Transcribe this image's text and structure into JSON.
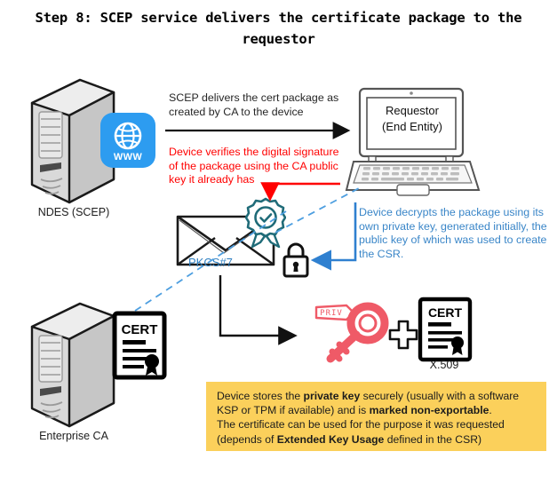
{
  "title": "Step 8: SCEP service delivers the certificate package to the requestor",
  "nodes": {
    "ndes_server": {
      "label": "NDES (SCEP)",
      "icon": "server-tower-icon",
      "badge": {
        "name": "www-globe-icon",
        "text": "WWW",
        "color": "#2d9cf0"
      }
    },
    "enterprise_ca": {
      "label": "Enterprise CA",
      "icon": "server-tower-icon",
      "cert_icon": {
        "name": "certificate-icon",
        "text": "CERT"
      }
    },
    "requestor": {
      "icon": "laptop-icon",
      "screen_line1": "Requestor",
      "screen_line2": "(End Entity)"
    },
    "package": {
      "icon": "envelope-icon",
      "label": "PKCS#7",
      "label_color": "#2e7fc1",
      "seal_icon": "signature-seal-rosette-icon",
      "seal_color": "#1f6b78",
      "lock_icon": "padlock-icon"
    },
    "private_key": {
      "icon": "private-key-icon",
      "tag_text": "PRIV",
      "color": "#ef5a67"
    },
    "plus": {
      "icon": "plus-icon"
    },
    "x509_cert": {
      "icon": "certificate-icon",
      "heading": "CERT",
      "label": "X.509"
    }
  },
  "annotations": {
    "scep_delivers": {
      "text": "SCEP delivers the cert package as created by CA to the device",
      "color": "#262626"
    },
    "device_verifies": {
      "text": "Device verifies the digital signature of the package using the CA public key it already has",
      "color": "#ff0000"
    },
    "device_decrypts": {
      "text": "Device decrypts the package using its own private key, generated initially, the public key of which was used to create the CSR.",
      "color": "#3a86c8"
    }
  },
  "callout": {
    "background": "#fbd05b",
    "lines": [
      [
        {
          "t": "Device stores the ",
          "b": false
        },
        {
          "t": "private key",
          "b": true
        },
        {
          "t": " securely (usually with a software",
          "b": false
        }
      ],
      [
        {
          "t": "KSP or TPM if available) and is ",
          "b": false
        },
        {
          "t": "marked non-exportable",
          "b": true
        },
        {
          "t": ".",
          "b": false
        }
      ],
      [
        {
          "t": "The certificate can be used for the purpose it was requested",
          "b": false
        }
      ],
      [
        {
          "t": "(depends of ",
          "b": false
        },
        {
          "t": "Extended Key Usage",
          "b": true
        },
        {
          "t": " defined in the CSR)",
          "b": false
        }
      ]
    ]
  },
  "connectors": {
    "delivery_arrow": {
      "name": "delivery-arrow",
      "color": "#111111"
    },
    "verify_arrow": {
      "name": "verify-arrow",
      "color": "#ff0000"
    },
    "decrypt_arrow": {
      "name": "decrypt-arrow",
      "color": "#2f80d0"
    },
    "unpack_arrow": {
      "name": "unpack-arrow",
      "color": "#111111"
    },
    "ca_dashed_line": {
      "name": "ca-trust-dashed-line",
      "color": "#4e9fe0"
    },
    "package_dashed_line": {
      "name": "package-dashed-line",
      "color": "#4e9fe0"
    }
  }
}
